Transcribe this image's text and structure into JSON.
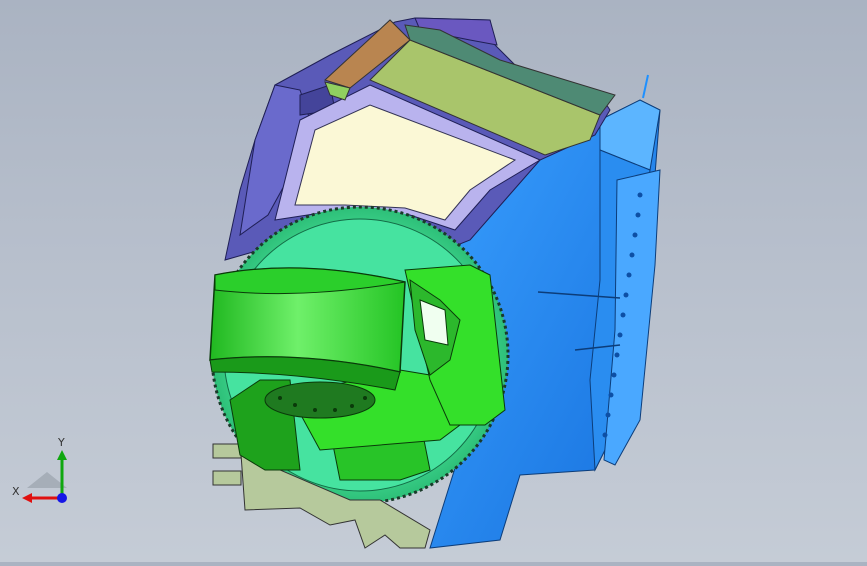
{
  "scene": {
    "model": "gimbal-mount-assembly",
    "colors": {
      "background_top": "#aab3c2",
      "background_bottom": "#c5ccd6",
      "blue_main": "#1e90ff",
      "blue_shade": "#1772d6",
      "purple": "#5a5ab8",
      "lavender": "#b9b3ee",
      "cream": "#fbf8d6",
      "olive": "#a9c56b",
      "teal": "#4e8a74",
      "brown": "#b98550",
      "green": "#34e02a",
      "green_dark": "#1ea21c",
      "mint": "#3fe6a0"
    }
  },
  "triad": {
    "x_label": "X",
    "y_label": "Y",
    "x_color": "#e01010",
    "y_color": "#0fa70f",
    "z_color": "#1616e6"
  }
}
